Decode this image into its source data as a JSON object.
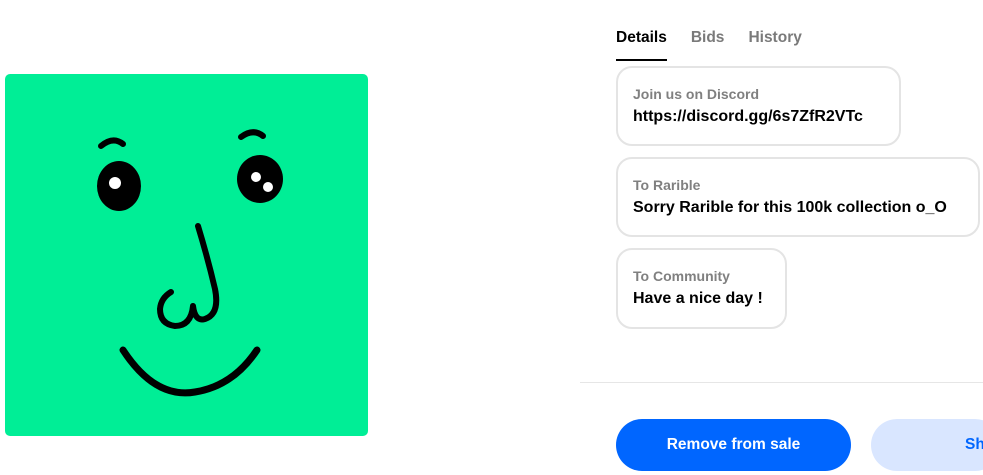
{
  "tabs": [
    {
      "label": "Details",
      "active": true
    },
    {
      "label": "Bids",
      "active": false
    },
    {
      "label": "History",
      "active": false
    }
  ],
  "properties": [
    {
      "label": "Join us on Discord",
      "value": "https://discord.gg/6s7ZfR2VTc"
    },
    {
      "label": "To Rarible",
      "value": "Sorry Rarible for this 100k collection o_O"
    },
    {
      "label": "To Community",
      "value": "Have a nice day !"
    }
  ],
  "actions": {
    "remove_label": "Remove from sale",
    "share_label": "Sh"
  },
  "colors": {
    "artwork_background": "#00ee96",
    "primary": "#0066ff",
    "secondary_bg": "#d9e6ff"
  }
}
